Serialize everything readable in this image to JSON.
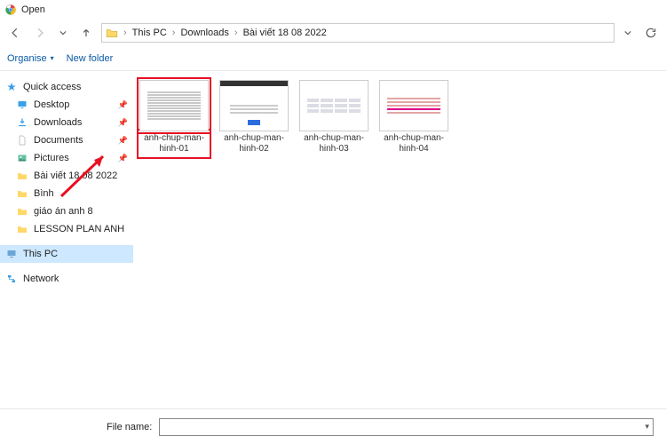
{
  "title": "Open",
  "breadcrumb": {
    "root": "This PC",
    "a": "Downloads",
    "b": "Bài viết 18 08 2022"
  },
  "toolbar": {
    "organise": "Organise",
    "newfolder": "New folder"
  },
  "sidebar": {
    "quick": "Quick access",
    "desktop": "Desktop",
    "downloads": "Downloads",
    "documents": "Documents",
    "pictures": "Pictures",
    "folder1": "Bài viết 18 08 2022",
    "folder2": "Bình",
    "folder3": "giáo án anh 8",
    "folder4": "LESSON PLAN ANH",
    "thispc": "This PC",
    "network": "Network"
  },
  "files": {
    "f1": "anh-chup-man-hinh-01",
    "f2": "anh-chup-man-hinh-02",
    "f3": "anh-chup-man-hinh-03",
    "f4": "anh-chup-man-hinh-04"
  },
  "bottom": {
    "label": "File name:",
    "value": ""
  }
}
